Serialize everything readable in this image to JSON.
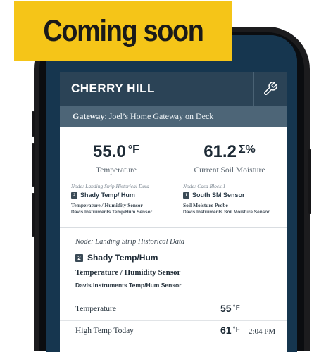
{
  "banner": {
    "text": "Coming soon",
    "bg_color": "#f5c518"
  },
  "header": {
    "site_name": "CHERRY HILL",
    "settings_icon": "wrench-icon"
  },
  "gateway": {
    "label": "Gateway",
    "value": ": Joel’s Home Gateway on Deck"
  },
  "readings": [
    {
      "value": "55.0",
      "unit": "°F",
      "label": "Temperature",
      "node": "Node: Landing Strip Historical Data",
      "badge": "2",
      "sensor_name": "Shady Temp/ Hum",
      "sensor_type": "Temperature / Humidity Sensor",
      "sensor_model": "Davis Instruments Temp/Hum Sensor"
    },
    {
      "value": "61.2",
      "unit": "Σ%",
      "label": "Current Soil Moisture",
      "node": "Node: Casa Block 1",
      "badge": "1",
      "sensor_name": "South SM Sensor",
      "sensor_type": "Soil Moisture Probe",
      "sensor_model": "Davis Instruments Soil Moisture Sensor"
    }
  ],
  "detail": {
    "node": "Node: Landing Strip Historical Data",
    "badge": "2",
    "sensor_name": "Shady Temp/Hum",
    "sensor_type": "Temperature / Humidity Sensor",
    "sensor_model": "Davis Instruments Temp/Hum Sensor",
    "metrics": [
      {
        "name": "Temperature",
        "value": "55",
        "unit": "°F",
        "time": ""
      },
      {
        "name": "High Temp Today",
        "value": "61",
        "unit": "°F",
        "time": "2:04 PM"
      }
    ]
  },
  "colors": {
    "screen_bg": "#16364f",
    "header_bg": "#2b4356",
    "gateway_bg": "#4d6577"
  }
}
